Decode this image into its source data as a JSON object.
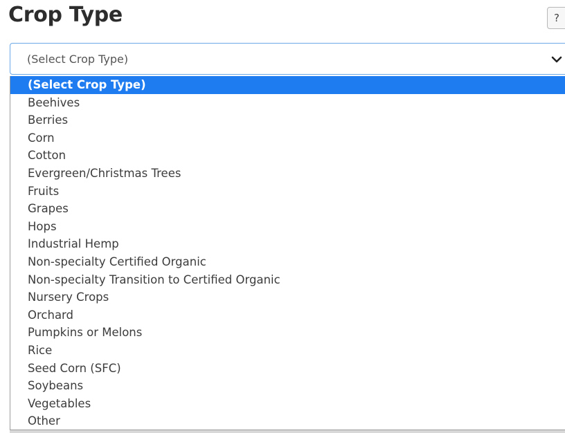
{
  "form": {
    "title": "Crop Type",
    "help_label": "?"
  },
  "select": {
    "value": "(Select Crop Type)",
    "options": [
      "(Select Crop Type)",
      "Beehives",
      "Berries",
      "Corn",
      "Cotton",
      "Evergreen/Christmas Trees",
      "Fruits",
      "Grapes",
      "Hops",
      "Industrial Hemp",
      "Non-specialty Certified Organic",
      "Non-specialty Transition to Certified Organic",
      "Nursery Crops",
      "Orchard",
      "Pumpkins or Melons",
      "Rice",
      "Seed Corn (SFC)",
      "Soybeans",
      "Vegetables",
      "Other"
    ],
    "selected_index": 0,
    "icon": "chevron-down-icon"
  },
  "colors": {
    "highlight": "#1e7cf0",
    "focus_border": "#6aa8e8",
    "title_text": "#2d2d2d"
  }
}
